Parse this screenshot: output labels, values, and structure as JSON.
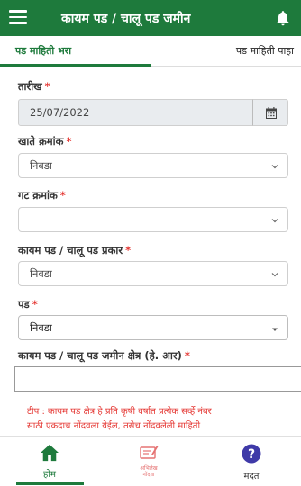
{
  "app_bar": {
    "title": "कायम पड / चालू पड जमीन",
    "menu_icon": "hamburger-menu-icon",
    "notification_icon": "bell-icon"
  },
  "tabs": [
    {
      "label": "पड माहिती भरा",
      "active": true
    },
    {
      "label": "पड माहिती पाहा",
      "active": false
    }
  ],
  "form": {
    "date": {
      "label": "तारीख",
      "required_mark": "*",
      "value": "25/07/2022",
      "icon": "calendar-icon"
    },
    "account_no": {
      "label": "खाते क्रमांक",
      "required_mark": "*",
      "value": "निवडा"
    },
    "gat_no": {
      "label": "गट क्रमांक",
      "required_mark": "*",
      "value": ""
    },
    "fallow_type": {
      "label": "कायम पड / चालू पड प्रकार",
      "required_mark": "*",
      "value": "निवडा"
    },
    "fallow": {
      "label": "पड",
      "required_mark": "*",
      "value": "निवडा"
    },
    "area": {
      "label": "कायम पड / चालू पड जमीन क्षेत्र (हे. आर)",
      "required_mark": "*",
      "value": ""
    }
  },
  "tip": {
    "line1": "टीप : कायम पड क्षेत्र हे प्रति कृषी वर्षात प्रत्येक सर्व्हे नंबर",
    "line2": "साठी एकदाच नोंदवला येईल, तसेच नोंदवलेली माहिती"
  },
  "bottom_nav": {
    "home": {
      "label": "होम",
      "icon": "home-icon"
    },
    "records": {
      "label_line1": "अभिलेख",
      "label_line2": "नोंदवा",
      "icon": "records-icon"
    },
    "help": {
      "label": "मदत",
      "icon": "help-icon"
    }
  },
  "colors": {
    "primary": "#1e7a3c",
    "required": "#e53935",
    "help_icon": "#3f3aa8"
  }
}
